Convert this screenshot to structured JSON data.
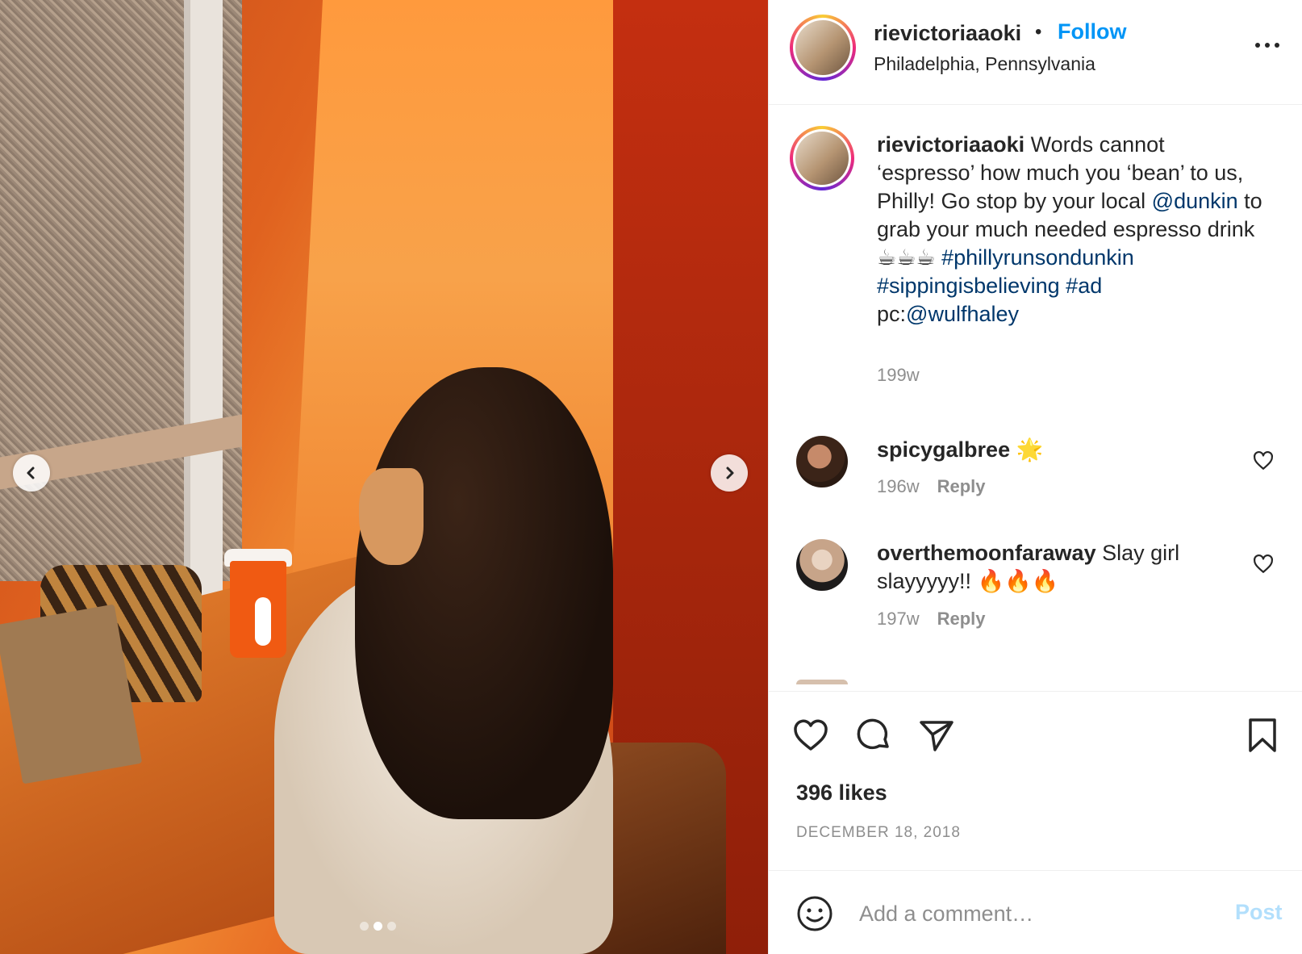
{
  "post": {
    "username": "rievictoriaaoki",
    "separator": "•",
    "follow_label": "Follow",
    "location": "Philadelphia, Pennsylvania",
    "caption": {
      "username": "rievictoriaaoki",
      "text_1": " Words cannot ‘espresso’ how much you ‘bean’ to us, Philly! Go stop by your local ",
      "mention_1": "@dunkin",
      "text_2": " to grab your much needed espresso drink ☕☕☕ ",
      "hashtag_1": "#phillyrunsondunkin",
      "hashtag_2": "#sippingisbelieving",
      "hashtag_3": "#ad",
      "text_3": "pc:",
      "mention_2": "@wulfhaley",
      "time": "199w"
    },
    "comments": [
      {
        "username": "spicygalbree",
        "text": " 🌟",
        "time": "196w",
        "reply_label": "Reply"
      },
      {
        "username": "overthemoonfaraway",
        "text": " Slay girl slayyyyy!! 🔥🔥🔥",
        "time": "197w",
        "reply_label": "Reply"
      }
    ],
    "likes": "396 likes",
    "date": "DECEMBER 18, 2018",
    "comment_input": {
      "placeholder": "Add a comment…",
      "post_label": "Post"
    },
    "carousel": {
      "count": 3,
      "active_index": 1
    }
  },
  "colors": {
    "accent": "#0095f6",
    "link": "#00376b",
    "muted": "#8e8e8e",
    "post_disabled": "#b2dffc"
  },
  "icons": [
    "chevron-left-icon",
    "chevron-right-icon",
    "more-icon",
    "heart-icon",
    "comment-icon",
    "share-icon",
    "bookmark-icon",
    "emoji-icon"
  ]
}
